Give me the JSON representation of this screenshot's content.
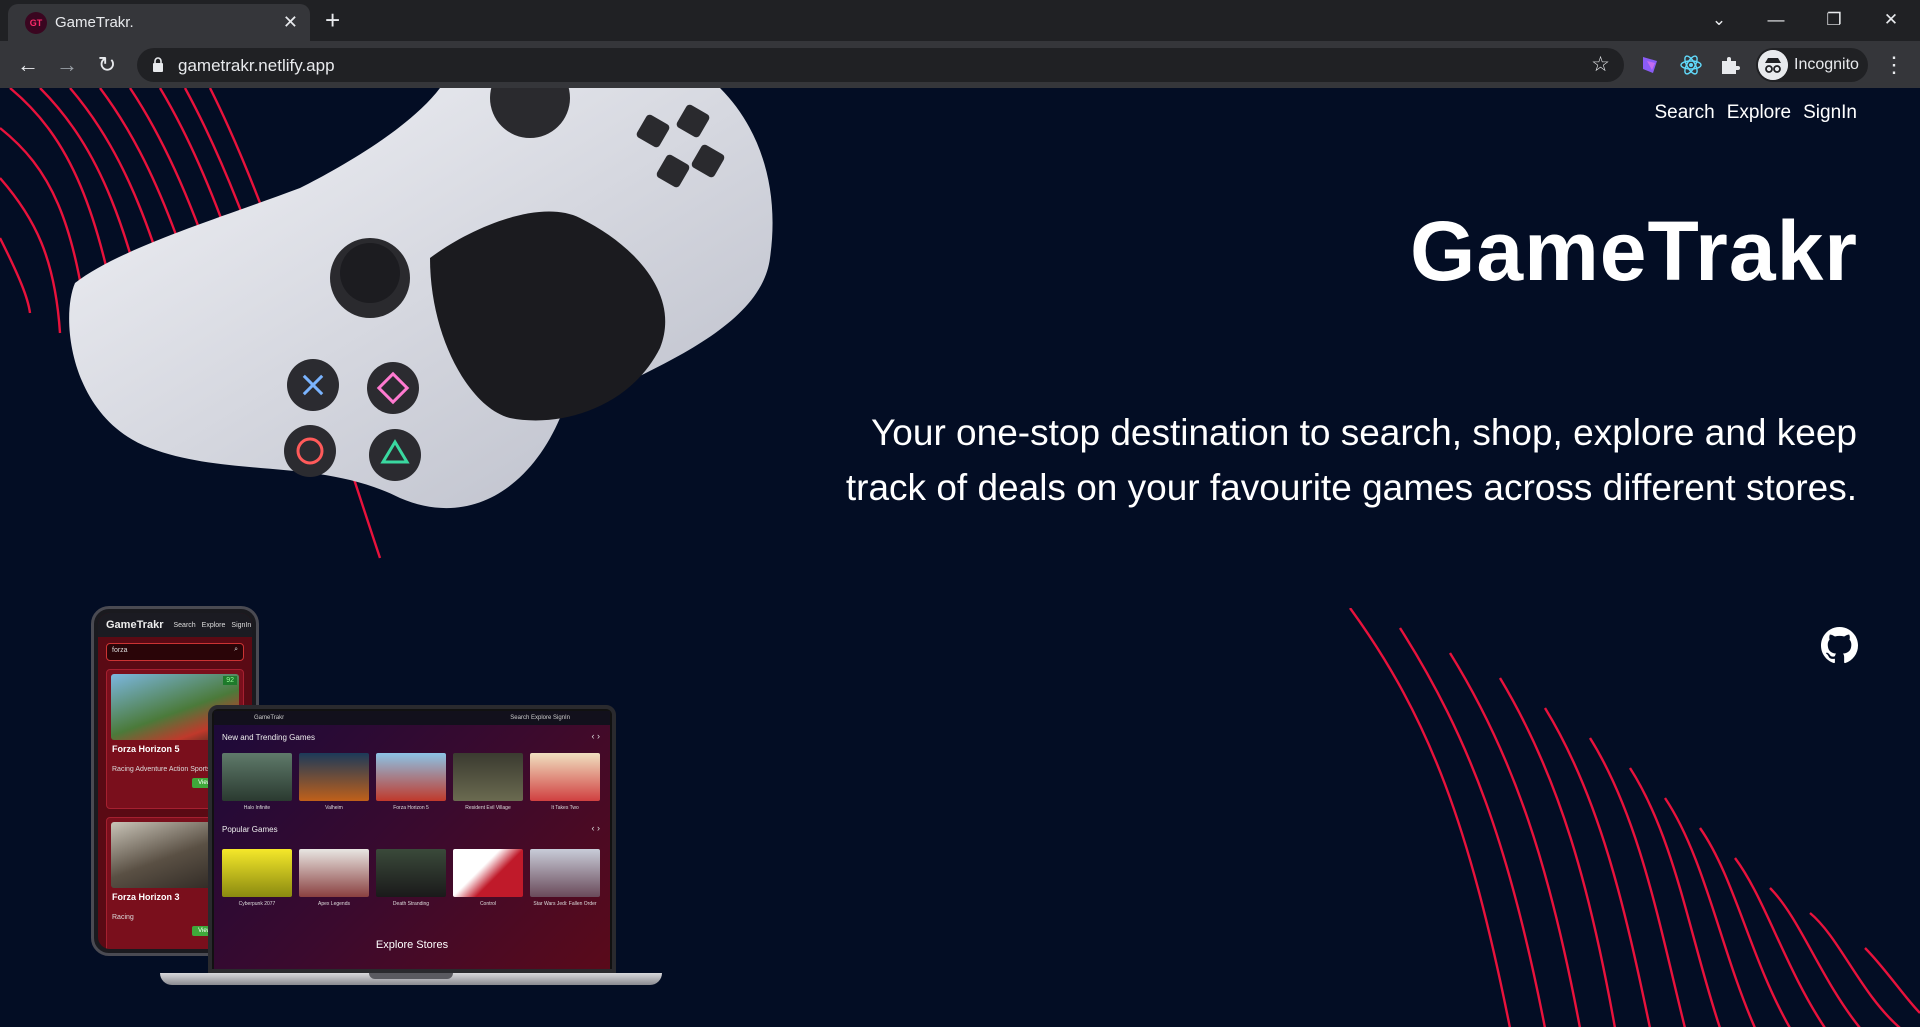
{
  "browser": {
    "tab_title": "GameTrakr.",
    "tab_favicon": "GT",
    "url": "gametrakr.netlify.app",
    "profile_label": "Incognito",
    "icons": [
      "back-icon",
      "forward-icon",
      "reload-icon",
      "lock-icon",
      "star-icon",
      "extension-icon",
      "menu-icon"
    ]
  },
  "nav": {
    "search": "Search",
    "explore": "Explore",
    "signin": "SignIn"
  },
  "hero": {
    "title": "GameTrakr",
    "tagline": "Your one-stop destination to search, shop, explore and keep track of deals on your favourite games across different stores."
  },
  "colors": {
    "background": "#030d24",
    "accent_red": "#e8123c",
    "text": "#ffffff"
  },
  "mockup": {
    "phone": {
      "logo": "GameTrakr",
      "nav": [
        "Search",
        "Explore",
        "SignIn"
      ],
      "search_value": "forza",
      "cards": [
        {
          "title": "Forza Horizon 5",
          "genres": "Racing Adventure Action Sports",
          "button": "View Game",
          "score": "92"
        },
        {
          "title": "Forza Horizon 3",
          "genres": "Racing",
          "button": "View Game"
        }
      ]
    },
    "laptop": {
      "logo": "GameTrakr",
      "nav": "Search  Explore  SignIn",
      "section_trending": "New and Trending Games",
      "trending": [
        "Halo Infinite",
        "Valheim",
        "Forza Horizon 5",
        "Resident Evil Village",
        "It Takes Two"
      ],
      "section_popular": "Popular Games",
      "popular": [
        "Cyberpunk 2077",
        "Apex Legends",
        "Death Stranding",
        "Control",
        "Star Wars Jedi: Fallen Order"
      ],
      "section_stores": "Explore Stores"
    }
  }
}
